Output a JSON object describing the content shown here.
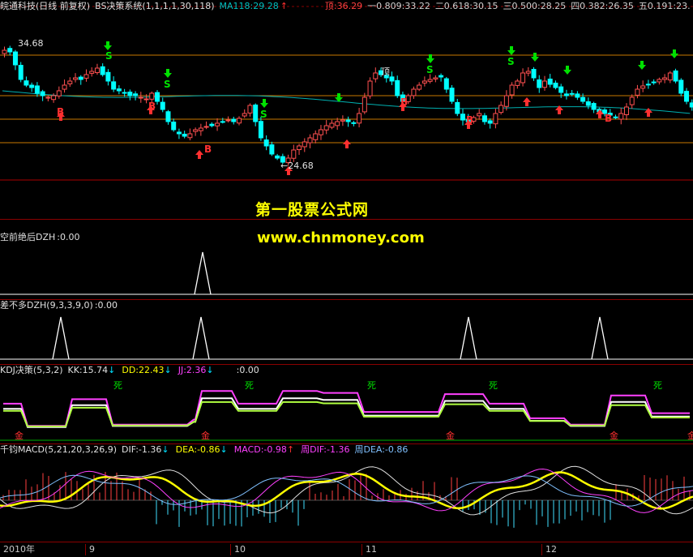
{
  "main": {
    "stock": "皖通科技(日线 前复权)",
    "indicator": "BS决策系统(1,1,1,1,30,118)",
    "ma": "MA118:29.28",
    "ding": "顶:36.29",
    "fib": [
      "一0.809:33.22",
      "二0.618:30.15",
      "三0.500:28.25",
      "四0.382:26.35",
      "五0.191:23."
    ],
    "high_label": "34.68",
    "low_label": "24.68",
    "ding_mark": "顶",
    "buy_letter": "B",
    "sell_letter": "S"
  },
  "watermark": {
    "title": "第一股票公式网",
    "url": "www.chnmoney.com"
  },
  "p1": {
    "label": "空前绝后DZH",
    "value": ":0.00"
  },
  "p2": {
    "label": "差不多DZH(9,3,3,9,0)",
    "value": ":0.00"
  },
  "kdj": {
    "label": "KDJ决策(5,3,2)",
    "kk": "KK:15.74",
    "dd": "DD:22.43",
    "jj": "JJ:2.36",
    "extra": ":0.00",
    "dead": "死",
    "gold": "金"
  },
  "macd": {
    "label": "千钧MACD(5,21,20,3,26,9)",
    "dif": "DIF:-1.36",
    "dea": "DEA:-0.86",
    "macd": "MACD:-0.98",
    "wdif": "周DIF:-1.36",
    "wdea": "周DEA:-0.86"
  },
  "axis": {
    "labels": [
      "2010年",
      "9",
      "10",
      "11",
      "12"
    ]
  },
  "colors": {
    "up": "#ff5050",
    "down": "#00ffff",
    "ma": "#00b0b0",
    "yellow": "#ffff00",
    "magenta": "#ff40ff",
    "green": "#00d000",
    "red": "#ff2020",
    "fib": "#c87800"
  }
}
